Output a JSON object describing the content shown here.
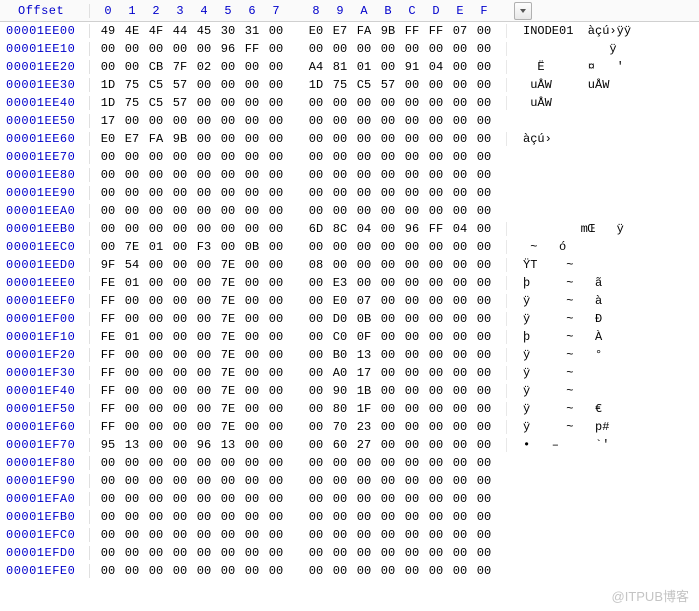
{
  "header": {
    "offset_label": "Offset",
    "columns": [
      "0",
      "1",
      "2",
      "3",
      "4",
      "5",
      "6",
      "7",
      "8",
      "9",
      "A",
      "B",
      "C",
      "D",
      "E",
      "F"
    ]
  },
  "rows": [
    {
      "offset": "00001EE00",
      "hex": [
        "49",
        "4E",
        "4F",
        "44",
        "45",
        "30",
        "31",
        "00",
        "E0",
        "E7",
        "FA",
        "9B",
        "FF",
        "FF",
        "07",
        "00"
      ],
      "ascii": "INODE01  àçú›ÿÿ "
    },
    {
      "offset": "00001EE10",
      "hex": [
        "00",
        "00",
        "00",
        "00",
        "00",
        "96",
        "FF",
        "00",
        "00",
        "00",
        "00",
        "00",
        "00",
        "00",
        "00",
        "00"
      ],
      "ascii": "            ÿ"
    },
    {
      "offset": "00001EE20",
      "hex": [
        "00",
        "00",
        "CB",
        "7F",
        "02",
        "00",
        "00",
        "00",
        "A4",
        "81",
        "01",
        "00",
        "91",
        "04",
        "00",
        "00"
      ],
      "ascii": "  Ë      ¤   '"
    },
    {
      "offset": "00001EE30",
      "hex": [
        "1D",
        "75",
        "C5",
        "57",
        "00",
        "00",
        "00",
        "00",
        "1D",
        "75",
        "C5",
        "57",
        "00",
        "00",
        "00",
        "00"
      ],
      "ascii": " uÅW     uÅW"
    },
    {
      "offset": "00001EE40",
      "hex": [
        "1D",
        "75",
        "C5",
        "57",
        "00",
        "00",
        "00",
        "00",
        "00",
        "00",
        "00",
        "00",
        "00",
        "00",
        "00",
        "00"
      ],
      "ascii": " uÅW"
    },
    {
      "offset": "00001EE50",
      "hex": [
        "17",
        "00",
        "00",
        "00",
        "00",
        "00",
        "00",
        "00",
        "00",
        "00",
        "00",
        "00",
        "00",
        "00",
        "00",
        "00"
      ],
      "ascii": ""
    },
    {
      "offset": "00001EE60",
      "hex": [
        "E0",
        "E7",
        "FA",
        "9B",
        "00",
        "00",
        "00",
        "00",
        "00",
        "00",
        "00",
        "00",
        "00",
        "00",
        "00",
        "00"
      ],
      "ascii": "àçú›"
    },
    {
      "offset": "00001EE70",
      "hex": [
        "00",
        "00",
        "00",
        "00",
        "00",
        "00",
        "00",
        "00",
        "00",
        "00",
        "00",
        "00",
        "00",
        "00",
        "00",
        "00"
      ],
      "ascii": ""
    },
    {
      "offset": "00001EE80",
      "hex": [
        "00",
        "00",
        "00",
        "00",
        "00",
        "00",
        "00",
        "00",
        "00",
        "00",
        "00",
        "00",
        "00",
        "00",
        "00",
        "00"
      ],
      "ascii": ""
    },
    {
      "offset": "00001EE90",
      "hex": [
        "00",
        "00",
        "00",
        "00",
        "00",
        "00",
        "00",
        "00",
        "00",
        "00",
        "00",
        "00",
        "00",
        "00",
        "00",
        "00"
      ],
      "ascii": ""
    },
    {
      "offset": "00001EEA0",
      "hex": [
        "00",
        "00",
        "00",
        "00",
        "00",
        "00",
        "00",
        "00",
        "00",
        "00",
        "00",
        "00",
        "00",
        "00",
        "00",
        "00"
      ],
      "ascii": ""
    },
    {
      "offset": "00001EEB0",
      "hex": [
        "00",
        "00",
        "00",
        "00",
        "00",
        "00",
        "00",
        "00",
        "6D",
        "8C",
        "04",
        "00",
        "96",
        "FF",
        "04",
        "00"
      ],
      "ascii": "        mŒ   ÿ"
    },
    {
      "offset": "00001EEC0",
      "hex": [
        "00",
        "7E",
        "01",
        "00",
        "F3",
        "00",
        "0B",
        "00",
        "00",
        "00",
        "00",
        "00",
        "00",
        "00",
        "00",
        "00"
      ],
      "ascii": " ~   ó"
    },
    {
      "offset": "00001EED0",
      "hex": [
        "9F",
        "54",
        "00",
        "00",
        "00",
        "7E",
        "00",
        "00",
        "08",
        "00",
        "00",
        "00",
        "00",
        "00",
        "00",
        "00"
      ],
      "ascii": "ŸT    ~"
    },
    {
      "offset": "00001EEE0",
      "hex": [
        "FE",
        "01",
        "00",
        "00",
        "00",
        "7E",
        "00",
        "00",
        "00",
        "E3",
        "00",
        "00",
        "00",
        "00",
        "00",
        "00"
      ],
      "ascii": "þ     ~   ã"
    },
    {
      "offset": "00001EEF0",
      "hex": [
        "FF",
        "00",
        "00",
        "00",
        "00",
        "7E",
        "00",
        "00",
        "00",
        "E0",
        "07",
        "00",
        "00",
        "00",
        "00",
        "00"
      ],
      "ascii": "ÿ     ~   à"
    },
    {
      "offset": "00001EF00",
      "hex": [
        "FF",
        "00",
        "00",
        "00",
        "00",
        "7E",
        "00",
        "00",
        "00",
        "D0",
        "0B",
        "00",
        "00",
        "00",
        "00",
        "00"
      ],
      "ascii": "ÿ     ~   Ð"
    },
    {
      "offset": "00001EF10",
      "hex": [
        "FE",
        "01",
        "00",
        "00",
        "00",
        "7E",
        "00",
        "00",
        "00",
        "C0",
        "0F",
        "00",
        "00",
        "00",
        "00",
        "00"
      ],
      "ascii": "þ     ~   À"
    },
    {
      "offset": "00001EF20",
      "hex": [
        "FF",
        "00",
        "00",
        "00",
        "00",
        "7E",
        "00",
        "00",
        "00",
        "B0",
        "13",
        "00",
        "00",
        "00",
        "00",
        "00"
      ],
      "ascii": "ÿ     ~   °"
    },
    {
      "offset": "00001EF30",
      "hex": [
        "FF",
        "00",
        "00",
        "00",
        "00",
        "7E",
        "00",
        "00",
        "00",
        "A0",
        "17",
        "00",
        "00",
        "00",
        "00",
        "00"
      ],
      "ascii": "ÿ     ~"
    },
    {
      "offset": "00001EF40",
      "hex": [
        "FF",
        "00",
        "00",
        "00",
        "00",
        "7E",
        "00",
        "00",
        "00",
        "90",
        "1B",
        "00",
        "00",
        "00",
        "00",
        "00"
      ],
      "ascii": "ÿ     ~"
    },
    {
      "offset": "00001EF50",
      "hex": [
        "FF",
        "00",
        "00",
        "00",
        "00",
        "7E",
        "00",
        "00",
        "00",
        "80",
        "1F",
        "00",
        "00",
        "00",
        "00",
        "00"
      ],
      "ascii": "ÿ     ~   €"
    },
    {
      "offset": "00001EF60",
      "hex": [
        "FF",
        "00",
        "00",
        "00",
        "00",
        "7E",
        "00",
        "00",
        "00",
        "70",
        "23",
        "00",
        "00",
        "00",
        "00",
        "00"
      ],
      "ascii": "ÿ     ~   p#"
    },
    {
      "offset": "00001EF70",
      "hex": [
        "95",
        "13",
        "00",
        "00",
        "96",
        "13",
        "00",
        "00",
        "00",
        "60",
        "27",
        "00",
        "00",
        "00",
        "00",
        "00"
      ],
      "ascii": "•   –     `'"
    },
    {
      "offset": "00001EF80",
      "hex": [
        "00",
        "00",
        "00",
        "00",
        "00",
        "00",
        "00",
        "00",
        "00",
        "00",
        "00",
        "00",
        "00",
        "00",
        "00",
        "00"
      ],
      "ascii": ""
    },
    {
      "offset": "00001EF90",
      "hex": [
        "00",
        "00",
        "00",
        "00",
        "00",
        "00",
        "00",
        "00",
        "00",
        "00",
        "00",
        "00",
        "00",
        "00",
        "00",
        "00"
      ],
      "ascii": ""
    },
    {
      "offset": "00001EFA0",
      "hex": [
        "00",
        "00",
        "00",
        "00",
        "00",
        "00",
        "00",
        "00",
        "00",
        "00",
        "00",
        "00",
        "00",
        "00",
        "00",
        "00"
      ],
      "ascii": ""
    },
    {
      "offset": "00001EFB0",
      "hex": [
        "00",
        "00",
        "00",
        "00",
        "00",
        "00",
        "00",
        "00",
        "00",
        "00",
        "00",
        "00",
        "00",
        "00",
        "00",
        "00"
      ],
      "ascii": ""
    },
    {
      "offset": "00001EFC0",
      "hex": [
        "00",
        "00",
        "00",
        "00",
        "00",
        "00",
        "00",
        "00",
        "00",
        "00",
        "00",
        "00",
        "00",
        "00",
        "00",
        "00"
      ],
      "ascii": ""
    },
    {
      "offset": "00001EFD0",
      "hex": [
        "00",
        "00",
        "00",
        "00",
        "00",
        "00",
        "00",
        "00",
        "00",
        "00",
        "00",
        "00",
        "00",
        "00",
        "00",
        "00"
      ],
      "ascii": ""
    },
    {
      "offset": "00001EFE0",
      "hex": [
        "00",
        "00",
        "00",
        "00",
        "00",
        "00",
        "00",
        "00",
        "00",
        "00",
        "00",
        "00",
        "00",
        "00",
        "00",
        "00"
      ],
      "ascii": ""
    }
  ],
  "watermark": "@ITPUB博客"
}
